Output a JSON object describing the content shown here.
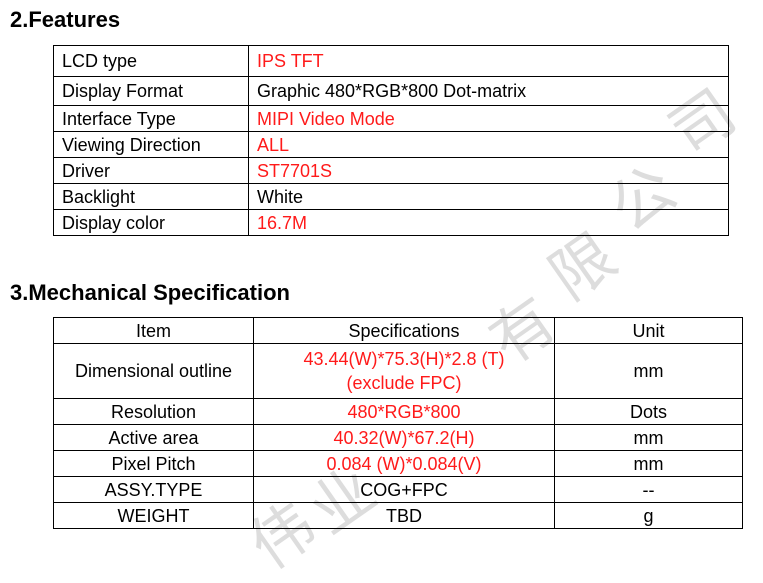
{
  "sections": {
    "features": {
      "title": "2.Features"
    },
    "mechanical": {
      "title": "3.Mechanical Specification"
    }
  },
  "features": [
    {
      "label": "LCD type",
      "value": "IPS TFT",
      "highlight": true
    },
    {
      "label": "Display Format",
      "value": "Graphic 480*RGB*800 Dot-matrix",
      "highlight": false
    },
    {
      "label": "Interface Type",
      "value": "MIPI Video Mode",
      "highlight": true
    },
    {
      "label": "Viewing Direction",
      "value": "ALL",
      "highlight": true
    },
    {
      "label": "Driver",
      "value": "ST7701S",
      "highlight": true
    },
    {
      "label": "Backlight",
      "value": "White",
      "highlight": false
    },
    {
      "label": "Display color",
      "value": "16.7M",
      "highlight": true
    }
  ],
  "mechanical": {
    "headers": [
      "Item",
      "Specifications",
      "Unit"
    ],
    "rows": [
      {
        "item": "Dimensional outline",
        "spec_line1": "43.44(W)*75.3(H)*2.8 (T)",
        "spec_line2": "(exclude FPC)",
        "unit": "mm",
        "highlight": true
      },
      {
        "item": "Resolution",
        "spec": "480*RGB*800",
        "unit": "Dots",
        "highlight": true
      },
      {
        "item": "Active area",
        "spec": "40.32(W)*67.2(H)",
        "unit": "mm",
        "highlight": true
      },
      {
        "item": "Pixel Pitch",
        "spec": "0.084 (W)*0.084(V)",
        "unit": "mm",
        "highlight": true
      },
      {
        "item": "ASSY.TYPE",
        "spec": "COG+FPC",
        "unit": "--",
        "highlight": false
      },
      {
        "item": "WEIGHT",
        "spec": "TBD",
        "unit": "g",
        "highlight": false
      }
    ]
  },
  "colors": {
    "highlight": "#ff1a1a",
    "text": "#000000",
    "border": "#000000"
  }
}
